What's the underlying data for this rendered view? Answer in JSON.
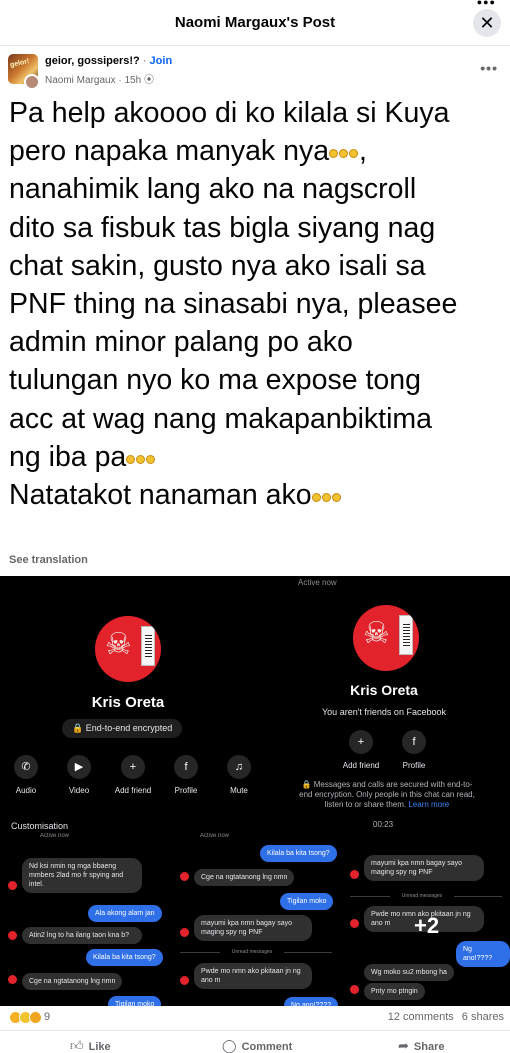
{
  "header": {
    "title": "Naomi Margaux's Post",
    "close_glyph": "✕"
  },
  "post": {
    "group_name": "geior, gossipers!?",
    "join_label": "Join",
    "author": "Naomi Margaux",
    "time": "15h",
    "lines": [
      "Pa help akoooo di ko kilala si Kuya",
      "pero napaka manyak nya",
      "nanahimik lang ako na nagscroll",
      "dito sa fisbuk tas bigla siyang nag",
      "chat sakin, gusto nya ako isali sa",
      "PNF thing na sinasabi nya, pleasee",
      "admin minor palang po ako",
      "tulungan nyo ko ma expose tong",
      "acc at wag nang makapanbiktima",
      "ng iba pa",
      "Natatakot nanaman ako"
    ],
    "see_translation": "See translation"
  },
  "shots": {
    "a": {
      "name": "Kris Oreta",
      "encrypted": "🔒 End-to-end encrypted",
      "actions": [
        "Audio",
        "Video",
        "Add friend",
        "Profile",
        "Mute"
      ],
      "customisation": "Customisation"
    },
    "b": {
      "active": "Active now",
      "name": "Kris Oreta",
      "sub": "You aren't friends on Facebook",
      "actions": [
        "Add friend",
        "Profile"
      ],
      "note": "🔒 Messages and calls are secured with end-to-end encryption. Only people in this chat can read, listen to or share them.",
      "learn_more": "Learn more",
      "timer": "00:23"
    },
    "c": {
      "active": "Active now",
      "m1": "Nd ksi nmin ng mga bbaeng mmbers 2lad mo  fr spying and intel.",
      "m2": "Ala akong alam jan",
      "m3": "Atin2 lng to ha ilang taon kna b?",
      "m4": "Kilala ba kita tsong?",
      "m5": "Cge na ngtatanong lng nmn",
      "m6": "Tigilan moko"
    },
    "d": {
      "active": "Active now",
      "m1": "Kilala ba kita tsong?",
      "m2": "Cge na ngtatanong lng nmn",
      "m3": "Tigilan moko",
      "m4": "mayumi kpa nmn bagay sayo maging spy ng PNF",
      "unread": "Unread messages",
      "m5": "Pwde mo nmn ako pkitaan jn ng ano m",
      "m6": "Ng ano!????"
    },
    "e": {
      "m1": "mayumi kpa nmn bagay sayo maging spy ng PNF",
      "unread": "Unread messages",
      "m2": "Pwde mo nmn ako pkitaan jn ng ano m",
      "more": "+2",
      "m3": "Ng ano!????",
      "m4": "Wg moko su2 mbong ha",
      "m5": "Pnty mo ptngin"
    }
  },
  "footer": {
    "reaction_count": "9",
    "comments": "12 comments",
    "shares": "6 shares",
    "like": "Like",
    "comment": "Comment",
    "share": "Share"
  },
  "colors": {
    "accent": "#0866ff",
    "messenger_blue": "#2f6fe8",
    "profile_red": "#e3232b",
    "secondary_text": "#65676b"
  }
}
